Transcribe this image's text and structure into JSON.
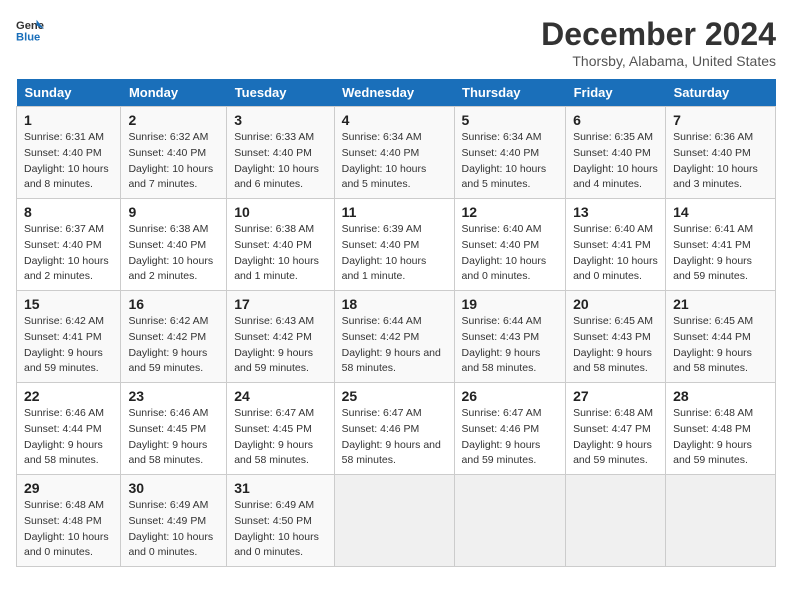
{
  "header": {
    "logo_line1": "General",
    "logo_line2": "Blue",
    "title": "December 2024",
    "subtitle": "Thorsby, Alabama, United States"
  },
  "days_of_week": [
    "Sunday",
    "Monday",
    "Tuesday",
    "Wednesday",
    "Thursday",
    "Friday",
    "Saturday"
  ],
  "weeks": [
    [
      {
        "day": 1,
        "sunrise": "6:31 AM",
        "sunset": "4:40 PM",
        "daylight": "10 hours and 8 minutes."
      },
      {
        "day": 2,
        "sunrise": "6:32 AM",
        "sunset": "4:40 PM",
        "daylight": "10 hours and 7 minutes."
      },
      {
        "day": 3,
        "sunrise": "6:33 AM",
        "sunset": "4:40 PM",
        "daylight": "10 hours and 6 minutes."
      },
      {
        "day": 4,
        "sunrise": "6:34 AM",
        "sunset": "4:40 PM",
        "daylight": "10 hours and 5 minutes."
      },
      {
        "day": 5,
        "sunrise": "6:34 AM",
        "sunset": "4:40 PM",
        "daylight": "10 hours and 5 minutes."
      },
      {
        "day": 6,
        "sunrise": "6:35 AM",
        "sunset": "4:40 PM",
        "daylight": "10 hours and 4 minutes."
      },
      {
        "day": 7,
        "sunrise": "6:36 AM",
        "sunset": "4:40 PM",
        "daylight": "10 hours and 3 minutes."
      }
    ],
    [
      {
        "day": 8,
        "sunrise": "6:37 AM",
        "sunset": "4:40 PM",
        "daylight": "10 hours and 2 minutes."
      },
      {
        "day": 9,
        "sunrise": "6:38 AM",
        "sunset": "4:40 PM",
        "daylight": "10 hours and 2 minutes."
      },
      {
        "day": 10,
        "sunrise": "6:38 AM",
        "sunset": "4:40 PM",
        "daylight": "10 hours and 1 minute."
      },
      {
        "day": 11,
        "sunrise": "6:39 AM",
        "sunset": "4:40 PM",
        "daylight": "10 hours and 1 minute."
      },
      {
        "day": 12,
        "sunrise": "6:40 AM",
        "sunset": "4:40 PM",
        "daylight": "10 hours and 0 minutes."
      },
      {
        "day": 13,
        "sunrise": "6:40 AM",
        "sunset": "4:41 PM",
        "daylight": "10 hours and 0 minutes."
      },
      {
        "day": 14,
        "sunrise": "6:41 AM",
        "sunset": "4:41 PM",
        "daylight": "9 hours and 59 minutes."
      }
    ],
    [
      {
        "day": 15,
        "sunrise": "6:42 AM",
        "sunset": "4:41 PM",
        "daylight": "9 hours and 59 minutes."
      },
      {
        "day": 16,
        "sunrise": "6:42 AM",
        "sunset": "4:42 PM",
        "daylight": "9 hours and 59 minutes."
      },
      {
        "day": 17,
        "sunrise": "6:43 AM",
        "sunset": "4:42 PM",
        "daylight": "9 hours and 59 minutes."
      },
      {
        "day": 18,
        "sunrise": "6:44 AM",
        "sunset": "4:42 PM",
        "daylight": "9 hours and 58 minutes."
      },
      {
        "day": 19,
        "sunrise": "6:44 AM",
        "sunset": "4:43 PM",
        "daylight": "9 hours and 58 minutes."
      },
      {
        "day": 20,
        "sunrise": "6:45 AM",
        "sunset": "4:43 PM",
        "daylight": "9 hours and 58 minutes."
      },
      {
        "day": 21,
        "sunrise": "6:45 AM",
        "sunset": "4:44 PM",
        "daylight": "9 hours and 58 minutes."
      }
    ],
    [
      {
        "day": 22,
        "sunrise": "6:46 AM",
        "sunset": "4:44 PM",
        "daylight": "9 hours and 58 minutes."
      },
      {
        "day": 23,
        "sunrise": "6:46 AM",
        "sunset": "4:45 PM",
        "daylight": "9 hours and 58 minutes."
      },
      {
        "day": 24,
        "sunrise": "6:47 AM",
        "sunset": "4:45 PM",
        "daylight": "9 hours and 58 minutes."
      },
      {
        "day": 25,
        "sunrise": "6:47 AM",
        "sunset": "4:46 PM",
        "daylight": "9 hours and 58 minutes."
      },
      {
        "day": 26,
        "sunrise": "6:47 AM",
        "sunset": "4:46 PM",
        "daylight": "9 hours and 59 minutes."
      },
      {
        "day": 27,
        "sunrise": "6:48 AM",
        "sunset": "4:47 PM",
        "daylight": "9 hours and 59 minutes."
      },
      {
        "day": 28,
        "sunrise": "6:48 AM",
        "sunset": "4:48 PM",
        "daylight": "9 hours and 59 minutes."
      }
    ],
    [
      {
        "day": 29,
        "sunrise": "6:48 AM",
        "sunset": "4:48 PM",
        "daylight": "10 hours and 0 minutes."
      },
      {
        "day": 30,
        "sunrise": "6:49 AM",
        "sunset": "4:49 PM",
        "daylight": "10 hours and 0 minutes."
      },
      {
        "day": 31,
        "sunrise": "6:49 AM",
        "sunset": "4:50 PM",
        "daylight": "10 hours and 0 minutes."
      },
      null,
      null,
      null,
      null
    ]
  ],
  "labels": {
    "sunrise_prefix": "Sunrise: ",
    "sunset_prefix": "Sunset: ",
    "daylight_prefix": "Daylight: "
  }
}
